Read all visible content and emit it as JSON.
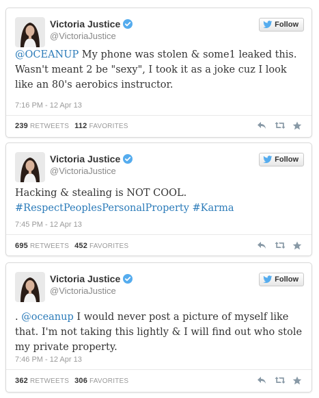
{
  "colors": {
    "link": "#2b7bb9",
    "text": "#333333",
    "muted": "#888888",
    "twitter_blue": "#55acee"
  },
  "icons": {
    "verified": "verified-badge-icon",
    "follow": "twitter-bird-icon",
    "reply": "reply-icon",
    "retweet": "retweet-icon",
    "favorite": "star-icon"
  },
  "tweets": [
    {
      "name": "Victoria Justice",
      "handle": "@VictoriaJustice",
      "follow_label": "Follow",
      "text_parts": [
        {
          "text": "@OCEANUP",
          "link": true
        },
        {
          "text": " My phone was stolen & some1 leaked this. Wasn't meant 2 be \"sexy\", I took it as a joke cuz I look like an 80's aerobics instructor.",
          "link": false
        }
      ],
      "timestamp": "7:16 PM - 12 Apr 13",
      "retweets": "239",
      "retweets_label": "RETWEETS",
      "favorites": "112",
      "favorites_label": "FAVORITES"
    },
    {
      "name": "Victoria Justice",
      "handle": "@VictoriaJustice",
      "follow_label": "Follow",
      "text_parts": [
        {
          "text": "Hacking & stealing is NOT COOL.",
          "link": false
        },
        {
          "text": "#RespectPeoplesPersonalProperty",
          "link": true
        },
        {
          "text": " ",
          "link": false
        },
        {
          "text": "#Karma",
          "link": true
        }
      ],
      "timestamp": "7:45 PM - 12 Apr 13",
      "retweets": "695",
      "retweets_label": "RETWEETS",
      "favorites": "452",
      "favorites_label": "FAVORITES"
    },
    {
      "name": "Victoria Justice",
      "handle": "@VictoriaJustice",
      "follow_label": "Follow",
      "text_parts": [
        {
          "text": ". ",
          "link": false
        },
        {
          "text": "@oceanup",
          "link": true
        },
        {
          "text": " I would never post a picture of myself like that. I'm not taking this lightly & I will find out who stole my private property.",
          "link": false
        }
      ],
      "timestamp": "7:46 PM - 12 Apr 13",
      "retweets": "362",
      "retweets_label": "RETWEETS",
      "favorites": "306",
      "favorites_label": "FAVORITES"
    }
  ]
}
